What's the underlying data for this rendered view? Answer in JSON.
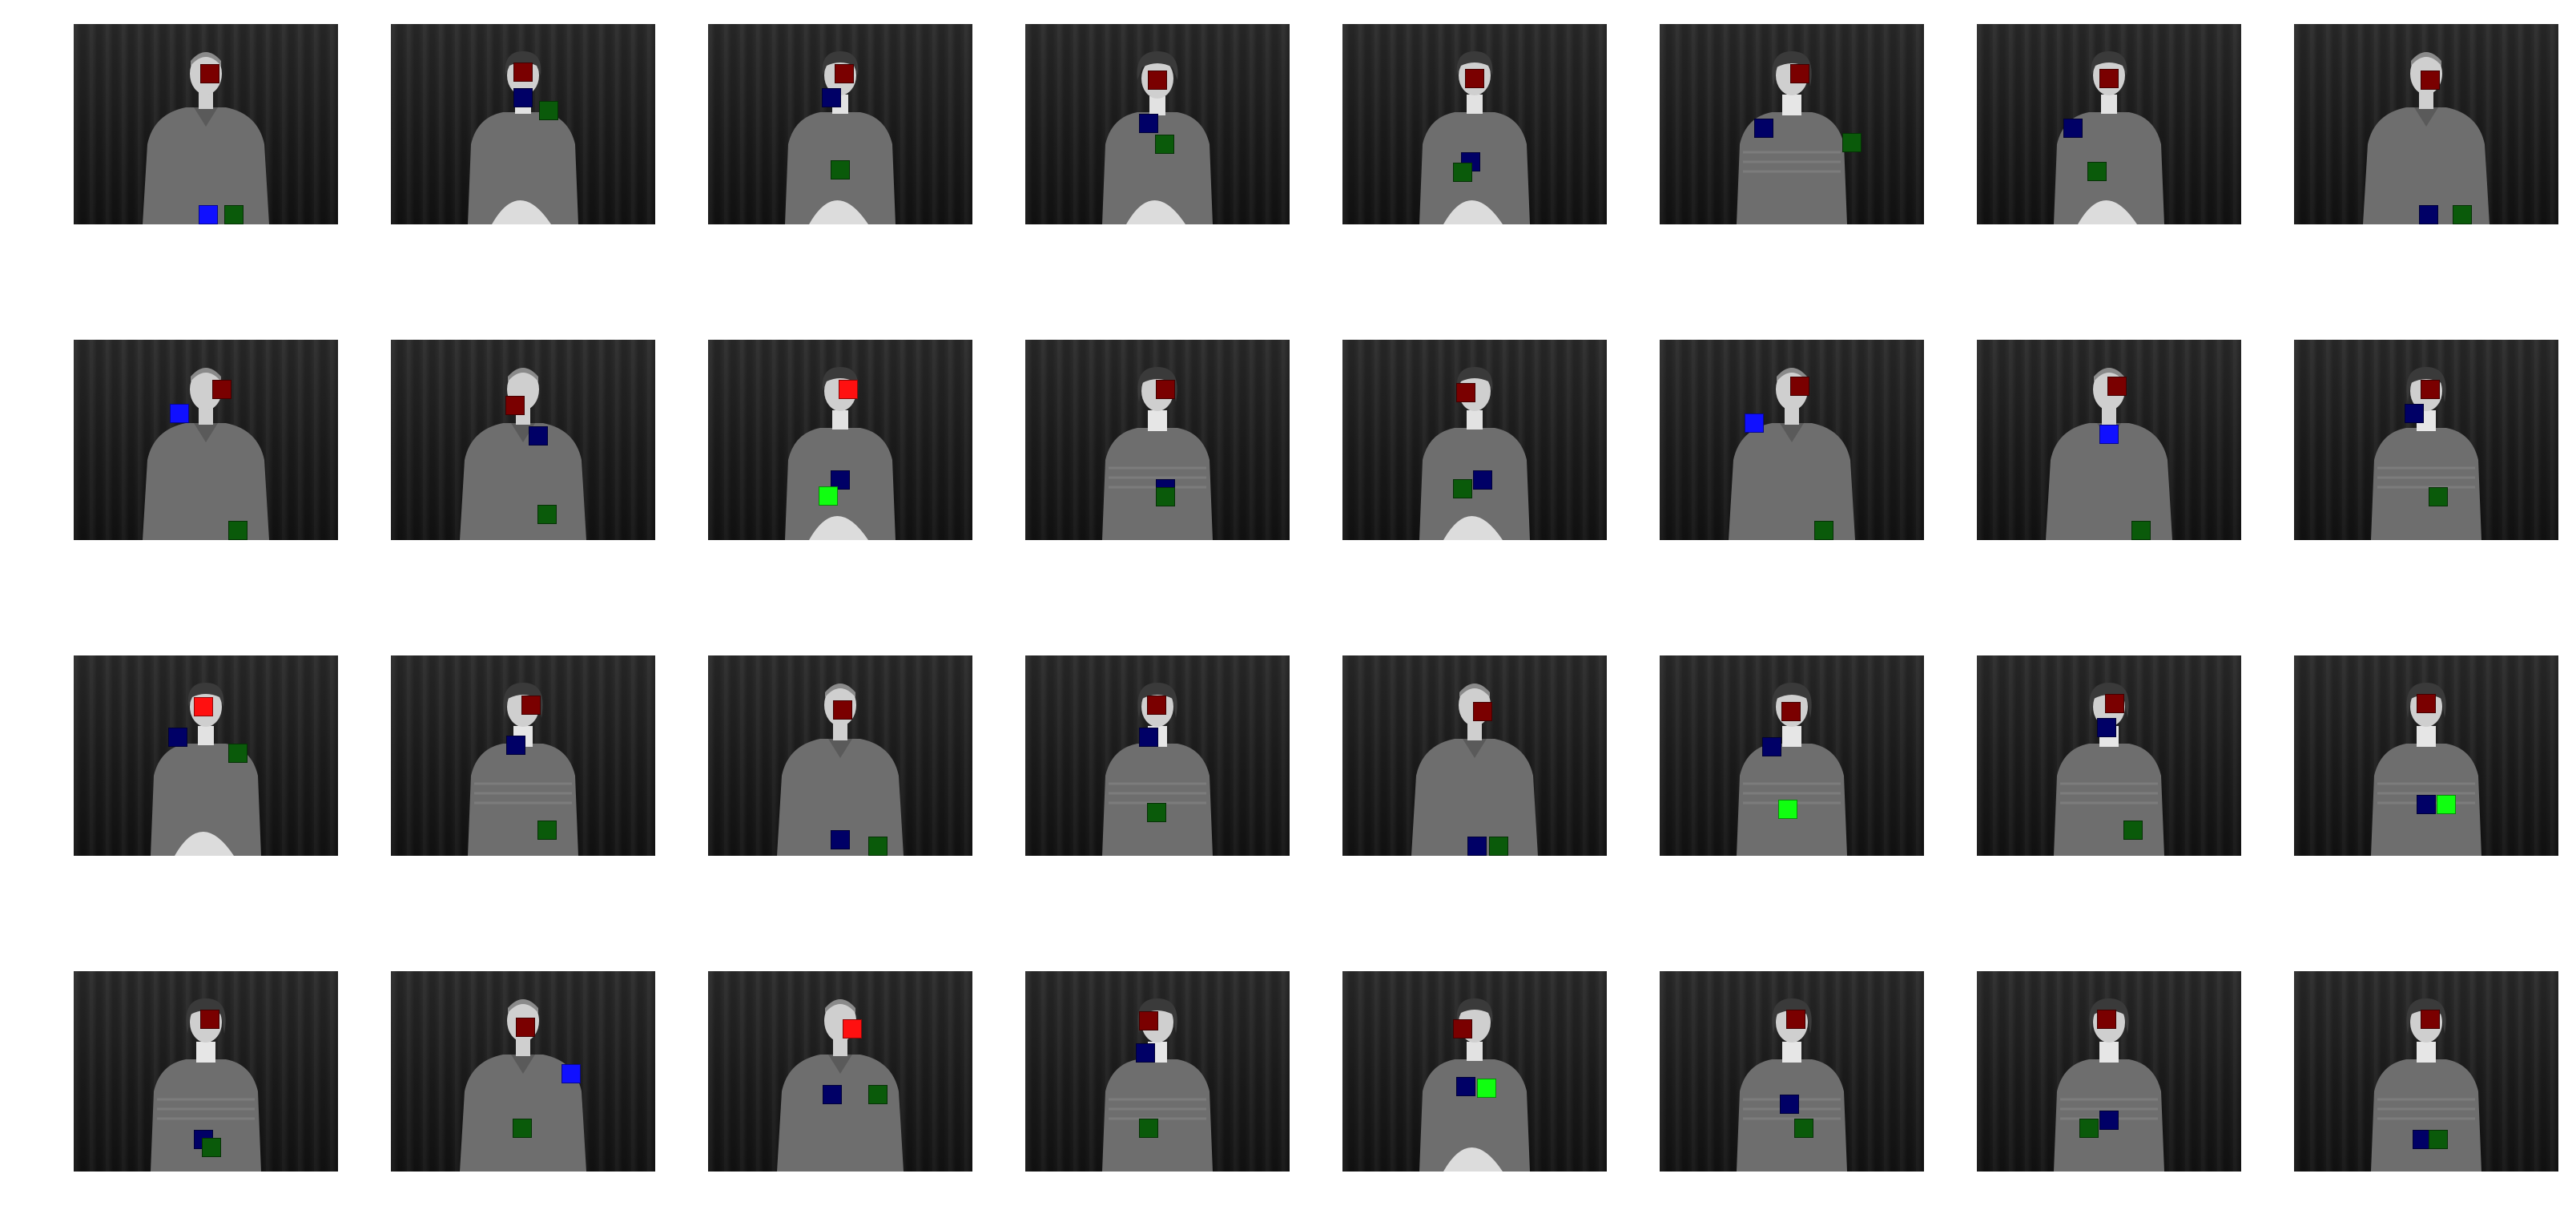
{
  "grid": {
    "rows": 4,
    "columns": 8
  },
  "colors": {
    "face_marker": "#7a0000",
    "face_marker_bright": "#ff1010",
    "right_hand_marker": "#000066",
    "right_hand_marker_bright": "#1010ff",
    "left_hand_marker": "#0a5a0a",
    "left_hand_marker_bright": "#10ff10",
    "curtain": "#1c1c1c",
    "signer_clothing": "#6e6e6e"
  },
  "frames": [
    {
      "signer": "man-shirt",
      "face": "dark",
      "right": "bright",
      "left": "dark"
    },
    {
      "signer": "woman-short",
      "face": "dark",
      "right": "dark",
      "left": "dark"
    },
    {
      "signer": "woman-short",
      "face": "dark",
      "right": "dark",
      "left": "dark"
    },
    {
      "signer": "woman-curly",
      "face": "dark",
      "right": "dark",
      "left": "dark"
    },
    {
      "signer": "woman-short",
      "face": "dark",
      "right": "dark",
      "left": "dark"
    },
    {
      "signer": "woman-long",
      "face": "dark",
      "right": "dark",
      "left": "dark"
    },
    {
      "signer": "woman-short",
      "face": "dark",
      "right": "dark",
      "left": "dark"
    },
    {
      "signer": "man-shirt",
      "face": "dark",
      "right": "dark",
      "left": "dark"
    },
    {
      "signer": "man-shirt",
      "face": "dark",
      "right": "bright",
      "left": "dark"
    },
    {
      "signer": "man-shirt",
      "face": "dark",
      "right": "dark",
      "left": "dark"
    },
    {
      "signer": "woman-short",
      "face": "bright",
      "right": "dark",
      "left": "bright"
    },
    {
      "signer": "woman-long",
      "face": "dark",
      "right": "dark",
      "left": "dark"
    },
    {
      "signer": "woman-short",
      "face": "dark",
      "right": "dark",
      "left": "dark"
    },
    {
      "signer": "man-shirt",
      "face": "dark",
      "right": "bright",
      "left": "dark"
    },
    {
      "signer": "man-shirt",
      "face": "dark",
      "right": "bright",
      "left": "dark"
    },
    {
      "signer": "woman-long",
      "face": "dark",
      "right": "dark",
      "left": "dark"
    },
    {
      "signer": "woman-short",
      "face": "bright",
      "right": "dark",
      "left": "dark"
    },
    {
      "signer": "woman-long",
      "face": "dark",
      "right": "dark",
      "left": "dark"
    },
    {
      "signer": "man-shirt",
      "face": "dark",
      "right": "dark",
      "left": "dark"
    },
    {
      "signer": "woman-long",
      "face": "dark",
      "right": "dark",
      "left": "dark"
    },
    {
      "signer": "man-shirt",
      "face": "dark",
      "right": "dark",
      "left": "dark"
    },
    {
      "signer": "woman-long",
      "face": "dark",
      "right": "dark",
      "left": "bright"
    },
    {
      "signer": "woman-long",
      "face": "dark",
      "right": "dark",
      "left": "dark"
    },
    {
      "signer": "woman-long",
      "face": "dark",
      "right": "dark",
      "left": "bright"
    },
    {
      "signer": "woman-long",
      "face": "dark",
      "right": "dark",
      "left": "dark"
    },
    {
      "signer": "man-shirt",
      "face": "dark",
      "right": "bright",
      "left": "dark"
    },
    {
      "signer": "man-shirt",
      "face": "bright",
      "right": "dark",
      "left": "dark"
    },
    {
      "signer": "woman-long",
      "face": "dark",
      "right": "dark",
      "left": "dark"
    },
    {
      "signer": "woman-short",
      "face": "dark",
      "right": "dark",
      "left": "bright"
    },
    {
      "signer": "woman-long",
      "face": "dark",
      "right": "dark",
      "left": "dark"
    },
    {
      "signer": "woman-long",
      "face": "dark",
      "right": "dark",
      "left": "dark"
    },
    {
      "signer": "woman-long",
      "face": "dark",
      "right": "dark",
      "left": "dark"
    }
  ]
}
